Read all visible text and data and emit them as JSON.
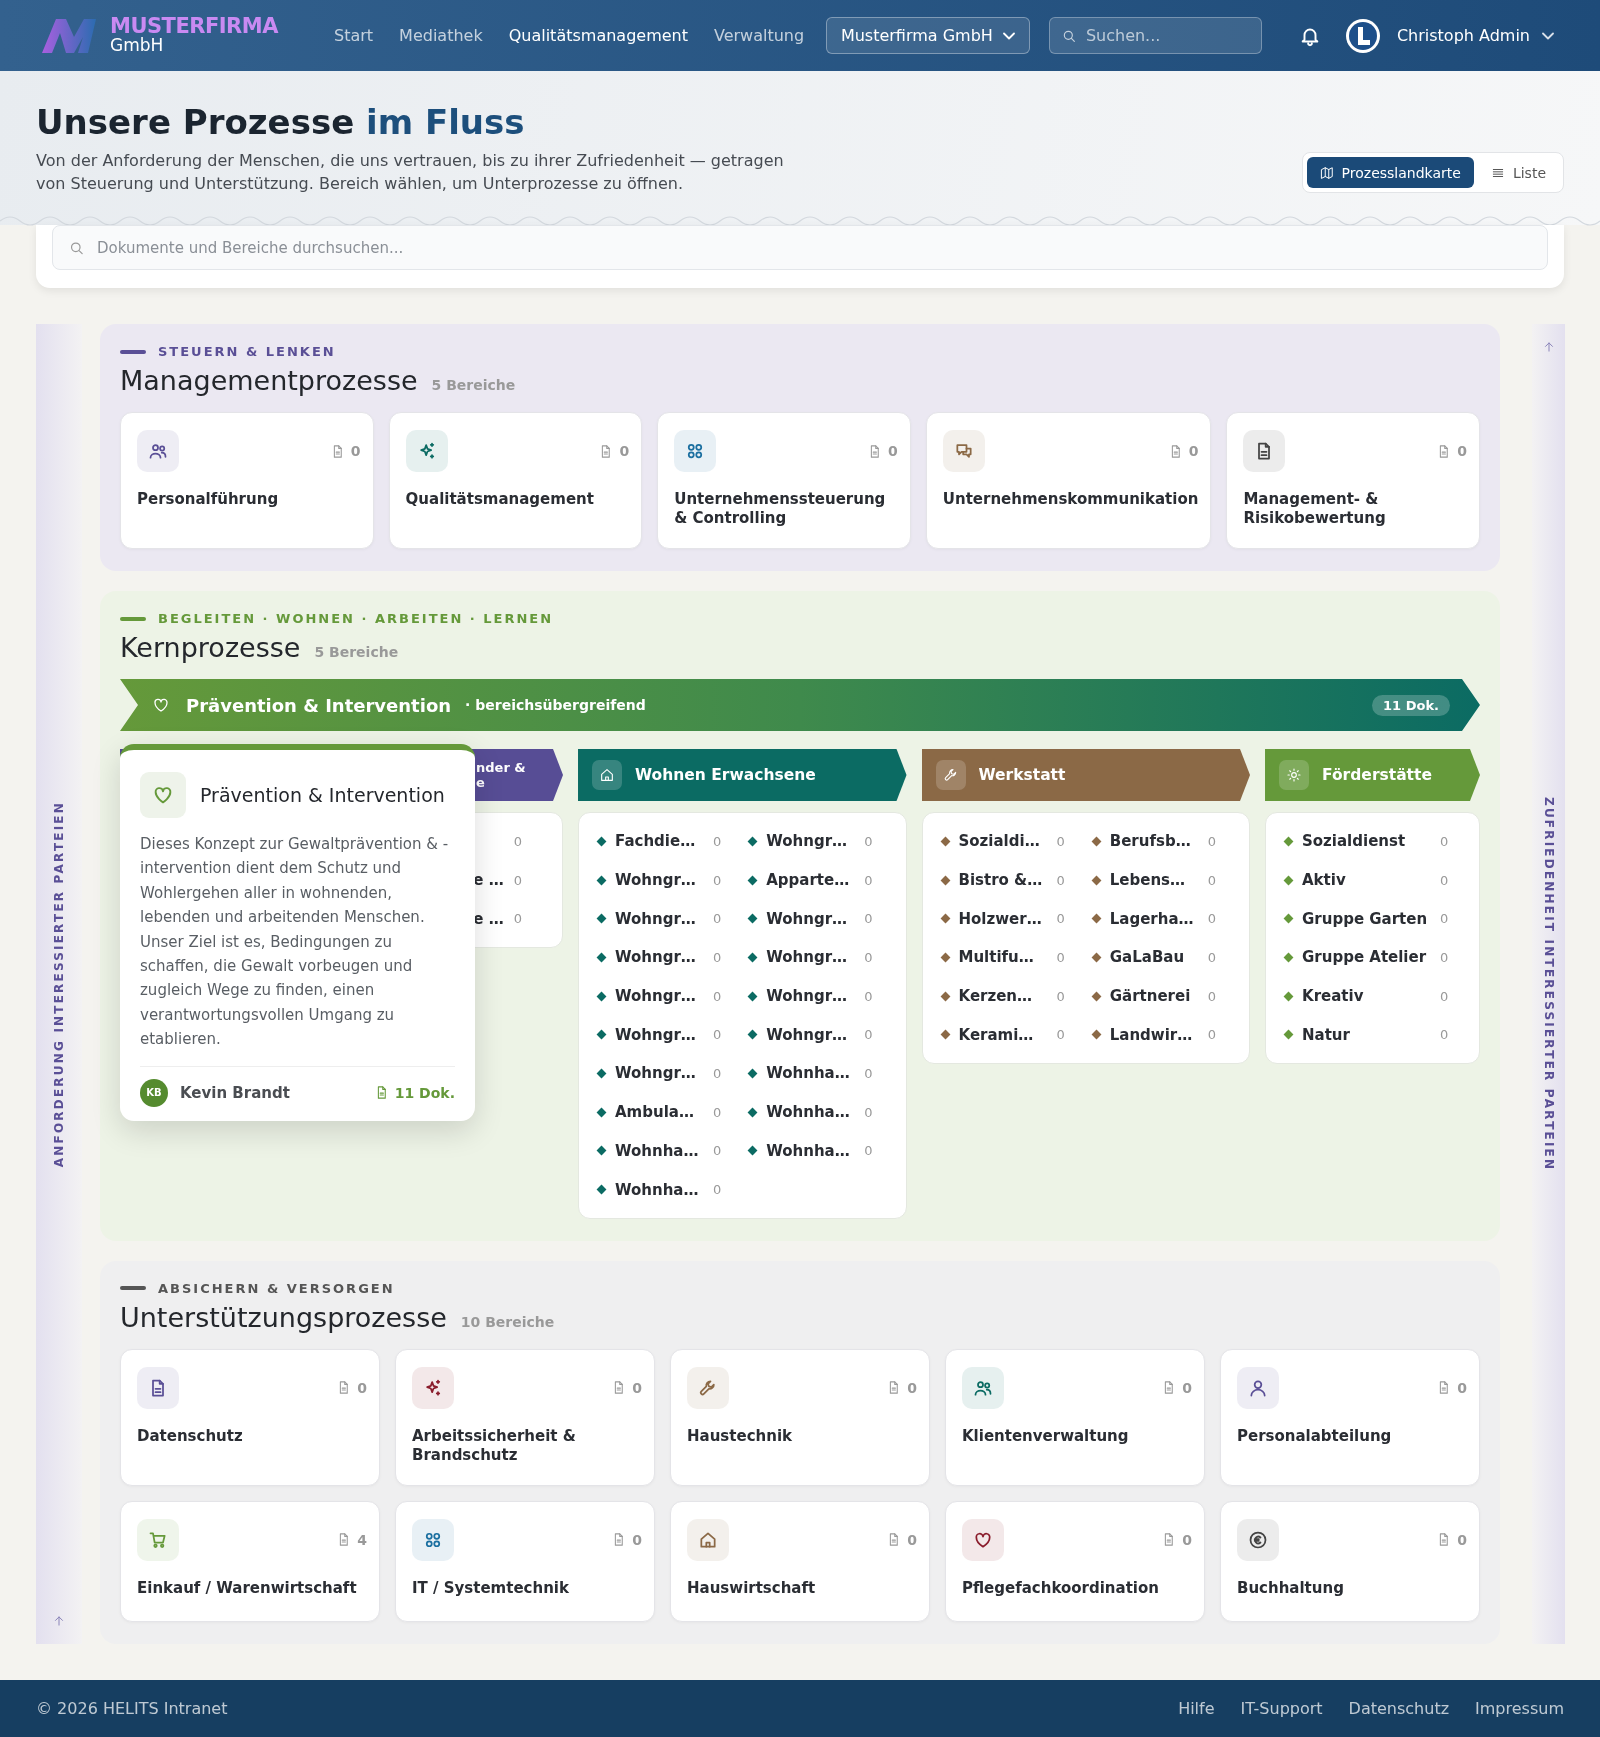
{
  "header": {
    "logo_top": "MUSTERFIRMA",
    "logo_bottom": "GmbH",
    "nav": [
      {
        "label": "Start",
        "selected": false
      },
      {
        "label": "Mediathek",
        "selected": false
      },
      {
        "label": "Qualitätsmanagement",
        "selected": true
      },
      {
        "label": "Verwaltung",
        "selected": false
      }
    ],
    "company": "Musterfirma GmbH",
    "search_placeholder": "Suchen...",
    "user": "Christoph Admin"
  },
  "hero": {
    "title": "Unsere Prozesse",
    "title_accent": "im Fluss",
    "description": "Von der Anforderung der Menschen, die uns vertrauen, bis zu ihrer Zufriedenheit — getragen von Steuerung und Unterstützung. Bereich wählen, um Unterprozesse zu öffnen.",
    "views": [
      {
        "label": "Prozesslandkarte",
        "selected": true
      },
      {
        "label": "Liste",
        "selected": false
      }
    ]
  },
  "search": {
    "placeholder": "Dokumente und Bereiche durchsuchen..."
  },
  "side_left": "ANFORDERUNG INTERESSIERTER PARTEIEN",
  "side_right": "ZUFRIEDENHEIT INTERESSIERTER PARTEIEN",
  "management": {
    "eyebrow": "STEUERN & LENKEN",
    "title": "Managementprozesse",
    "count": "5 Bereiche",
    "cards": [
      {
        "name": "Personalführung",
        "docs": "0",
        "color": "#5a4f96"
      },
      {
        "name": "Qualitätsmanagement",
        "docs": "0",
        "color": "#0b6b63"
      },
      {
        "name": "Unternehmenssteuerung & Controlling",
        "docs": "0",
        "color": "#1b6fa0"
      },
      {
        "name": "Unternehmenskommunikation",
        "docs": "0",
        "color": "#8b6946"
      },
      {
        "name": "Management- & Risikobewertung",
        "docs": "0",
        "color": "#444444"
      }
    ]
  },
  "core": {
    "eyebrow": "BEGLEITEN · WOHNEN · ARBEITEN · LERNEN",
    "title": "Kernprozesse",
    "count": "5 Bereiche",
    "banner": {
      "title": "Prävention & Intervention",
      "subtitle": "· bereichsübergreifend",
      "docs": "11 Dok."
    },
    "columns": [
      {
        "title_lines": [
          "nder &",
          "e"
        ],
        "color": "#574d95",
        "items": [
          {
            "count": "0"
          },
          {
            "name": "e …",
            "count": "0"
          },
          {
            "name": "e …",
            "count": "0"
          }
        ]
      },
      {
        "title_lines": [
          "Wohnen Erwachsene"
        ],
        "color": "#0b6b63",
        "items": [
          {
            "name": "Fachdie…",
            "count": "0"
          },
          {
            "name": "Wohngr…",
            "count": "0"
          },
          {
            "name": "Wohngr…",
            "count": "0"
          },
          {
            "name": "Apparte…",
            "count": "0"
          },
          {
            "name": "Wohngr…",
            "count": "0"
          },
          {
            "name": "Wohngr…",
            "count": "0"
          },
          {
            "name": "Wohngr…",
            "count": "0"
          },
          {
            "name": "Wohngr…",
            "count": "0"
          },
          {
            "name": "Wohngr…",
            "count": "0"
          },
          {
            "name": "Wohngr…",
            "count": "0"
          },
          {
            "name": "Wohngr…",
            "count": "0"
          },
          {
            "name": "Wohngr…",
            "count": "0"
          },
          {
            "name": "Wohngr…",
            "count": "0"
          },
          {
            "name": "Wohnha…",
            "count": "0"
          },
          {
            "name": "Ambula…",
            "count": "0"
          },
          {
            "name": "Wohnha…",
            "count": "0"
          },
          {
            "name": "Wohnha…",
            "count": "0"
          },
          {
            "name": "Wohnha…",
            "count": "0"
          },
          {
            "name": "Wohnha…",
            "count": "0"
          }
        ]
      },
      {
        "title_lines": [
          "Werkstatt"
        ],
        "color": "#8b6946",
        "items": [
          {
            "name": "Sozialdi…",
            "count": "0"
          },
          {
            "name": "Berufsb…",
            "count": "0"
          },
          {
            "name": "Bistro &…",
            "count": "0"
          },
          {
            "name": "Lebens…",
            "count": "0"
          },
          {
            "name": "Holzwer…",
            "count": "0"
          },
          {
            "name": "Lagerha…",
            "count": "0"
          },
          {
            "name": "Multifu…",
            "count": "0"
          },
          {
            "name": "GaLaBau",
            "count": "0"
          },
          {
            "name": "Kerzen…",
            "count": "0"
          },
          {
            "name": "Gärtnerei",
            "count": "0"
          },
          {
            "name": "Kerami…",
            "count": "0"
          },
          {
            "name": "Landwir…",
            "count": "0"
          }
        ]
      },
      {
        "title_lines": [
          "Förderstätte"
        ],
        "color": "#65993a",
        "items": [
          {
            "name": "Sozialdienst",
            "count": "0"
          },
          {
            "name": "Aktiv",
            "count": "0"
          },
          {
            "name": "Gruppe Garten",
            "count": "0"
          },
          {
            "name": "Gruppe Atelier",
            "count": "0"
          },
          {
            "name": "Kreativ",
            "count": "0"
          },
          {
            "name": "Natur",
            "count": "0"
          }
        ]
      }
    ],
    "popover": {
      "title": "Prävention & Intervention",
      "text": "Dieses Konzept zur Gewaltprävention & -intervention dient dem Schutz und Wohlergehen aller in wohnenden, lebenden und arbeitenden Menschen. Unser Ziel ist es, Bedingungen zu schaffen, die Gewalt vorbeugen und zugleich Wege zu finden, einen verantwortungsvollen Umgang zu etablieren.",
      "initials": "KB",
      "author": "Kevin Brandt",
      "docs": "11 Dok."
    }
  },
  "support": {
    "eyebrow": "ABSICHERN & VERSORGEN",
    "title": "Unterstützungsprozesse",
    "count": "10 Bereiche",
    "cards": [
      {
        "name": "Datenschutz",
        "docs": "0",
        "color": "#5a4f96"
      },
      {
        "name": "Arbeitssicherheit & Brandschutz",
        "docs": "0",
        "color": "#8a1c2c"
      },
      {
        "name": "Haustechnik",
        "docs": "0",
        "color": "#8b6946"
      },
      {
        "name": "Klientenverwaltung",
        "docs": "0",
        "color": "#0b6b63"
      },
      {
        "name": "Personalabteilung",
        "docs": "0",
        "color": "#5a4f96"
      },
      {
        "name": "Einkauf / Warenwirtschaft",
        "docs": "4",
        "color": "#65993a"
      },
      {
        "name": "IT / Systemtechnik",
        "docs": "0",
        "color": "#1b6fa0"
      },
      {
        "name": "Hauswirtschaft",
        "docs": "0",
        "color": "#8b6946"
      },
      {
        "name": "Pflegefachkoordination",
        "docs": "0",
        "color": "#8a1c2c"
      },
      {
        "name": "Buchhaltung",
        "docs": "0",
        "color": "#444444"
      }
    ]
  },
  "footer": {
    "copyright": "© 2026 HELITS Intranet",
    "links": [
      "Hilfe",
      "IT-Support",
      "Datenschutz",
      "Impressum"
    ]
  }
}
